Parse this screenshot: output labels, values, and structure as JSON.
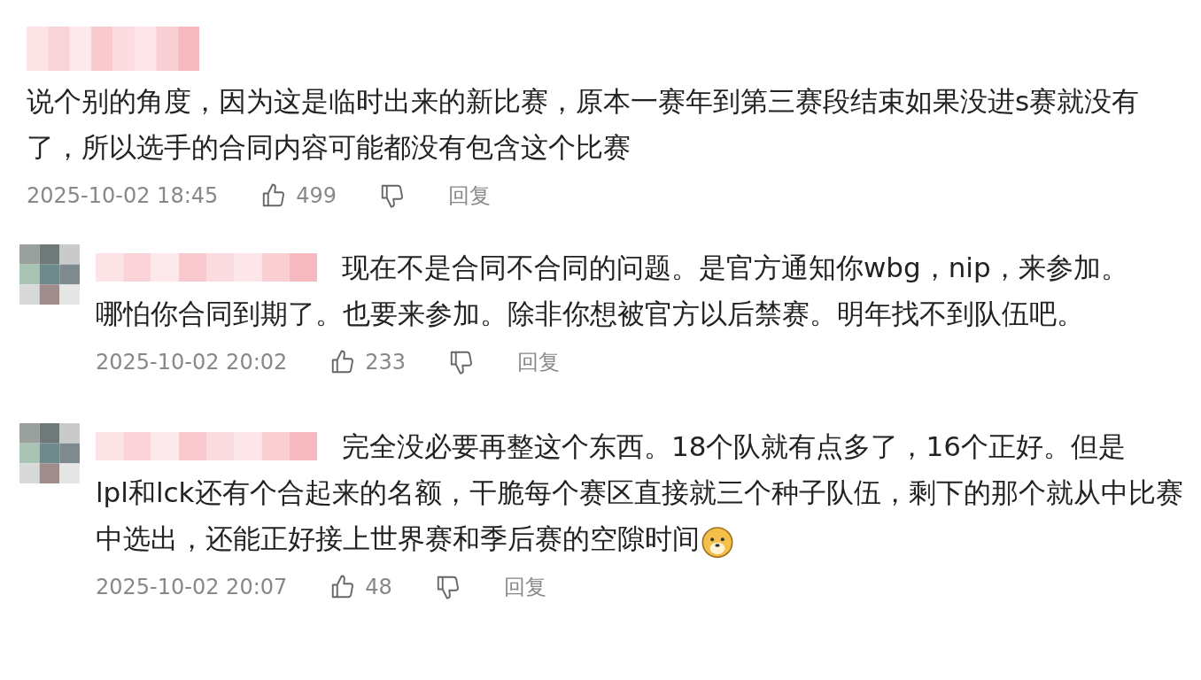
{
  "comments": [
    {
      "kind": "top",
      "text": "说个别的角度，因为这是临时出来的新比赛，原本一赛年到第三赛段结束如果没进s赛就没有了，所以选手的合同内容可能都没有包含这个比赛",
      "time": "2025-10-02 18:45",
      "likes": "499",
      "reply_label": "回复",
      "emoji": false
    },
    {
      "kind": "reply",
      "first_line": "现在不是合同不合同的问题。是官方通知你wbg，nip，来参加。",
      "rest": "哪怕你合同到期了。也要来参加。除非你想被官方以后禁赛。明年找不到队伍吧。",
      "time": "2025-10-02 20:02",
      "likes": "233",
      "reply_label": "回复",
      "emoji": false
    },
    {
      "kind": "reply",
      "first_line": "完全没必要再整这个东西。18个队就有点多了，16个正好。但是",
      "rest": "lpl和lck还有个合起来的名额，干脆每个赛区直接就三个种子队伍，剩下的那个就从中比赛中选出，还能正好接上世界赛和季后赛的空隙时间",
      "time": "2025-10-02 20:07",
      "likes": "48",
      "reply_label": "回复",
      "emoji": true
    }
  ]
}
